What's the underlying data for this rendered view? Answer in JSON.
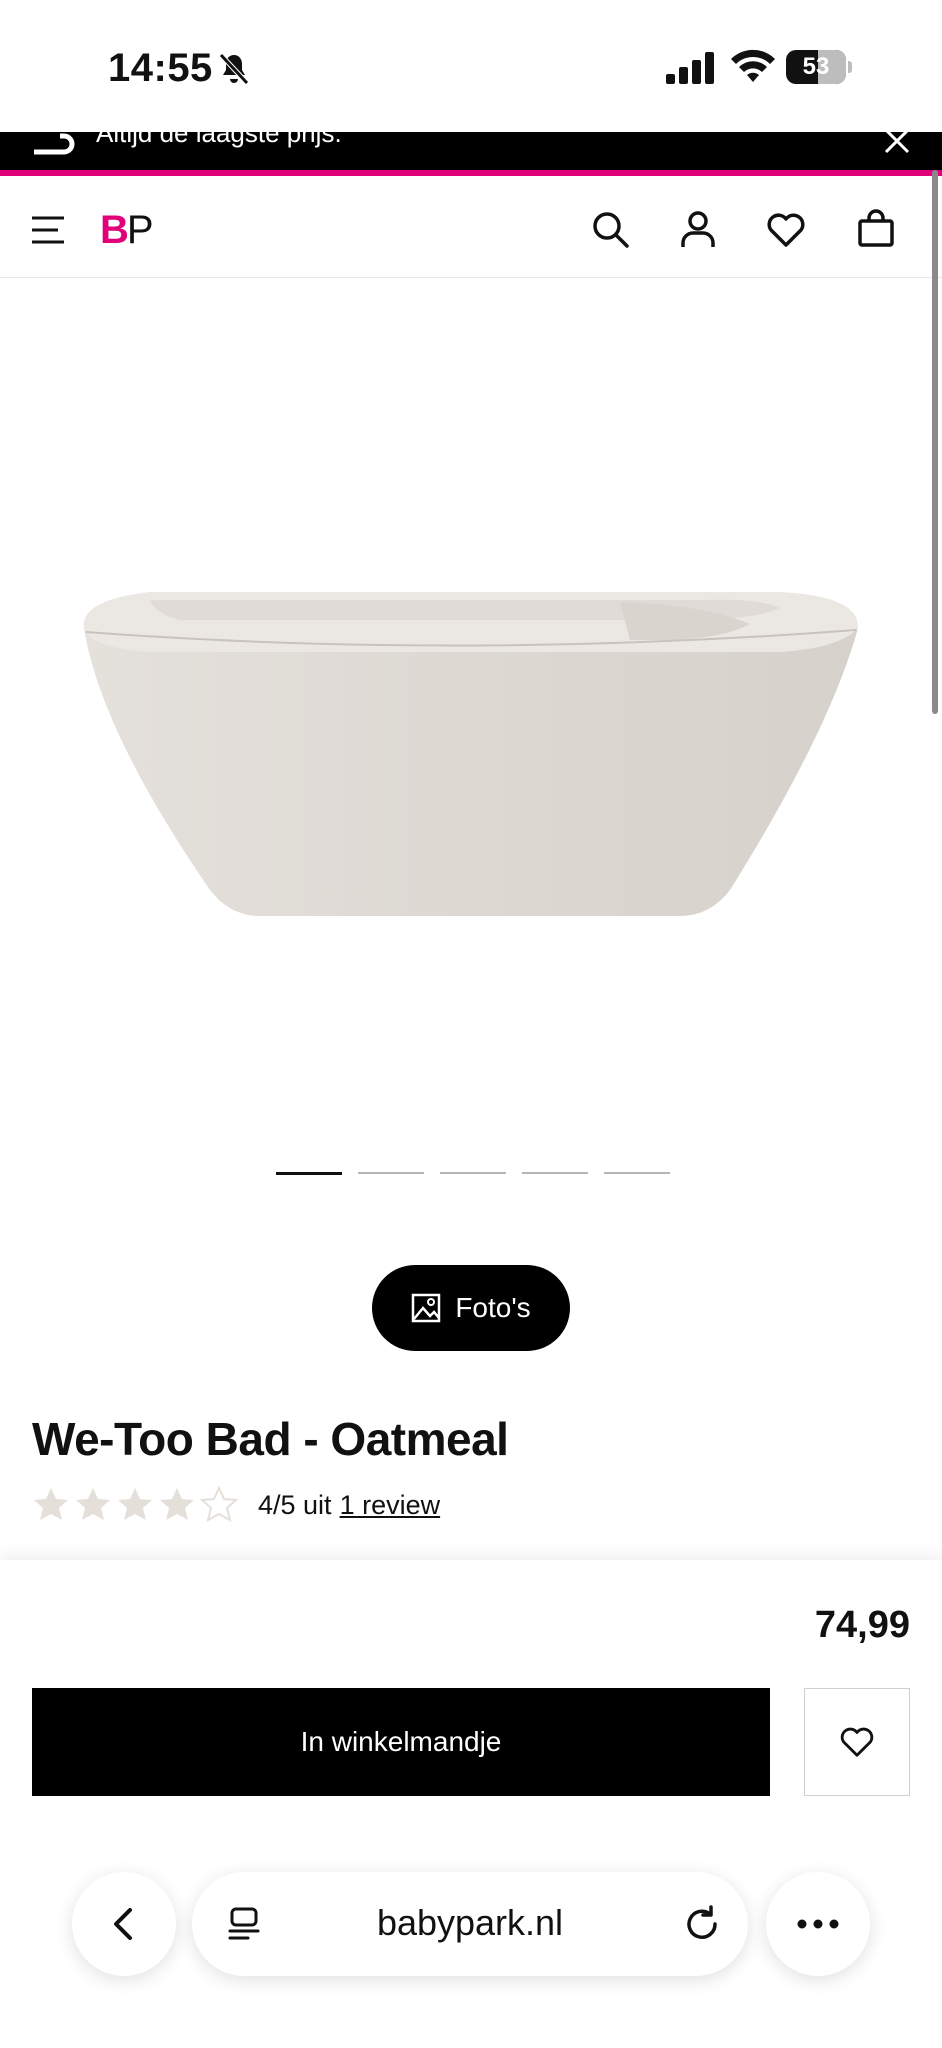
{
  "status_bar": {
    "time": "14:55",
    "battery": "53",
    "battery_level": 0.53
  },
  "promo": {
    "text": "Altijd de laagste prijs."
  },
  "header": {
    "logo_b": "B",
    "logo_p": "P"
  },
  "product": {
    "carousel_count": 5,
    "carousel_active": 1,
    "photos_label": "Foto's",
    "title": "We-Too Bad - Oatmeal",
    "rating_value": 4,
    "rating_max": 5,
    "rating_text": "4/5 uit",
    "review_link": "1  review",
    "price": "74,99",
    "add_to_cart": "In winkelmandje"
  },
  "browser": {
    "url": "babypark.nl"
  },
  "colors": {
    "brand": "#e2007a",
    "star_filled": "#e5dfda",
    "star_empty": "#e5dfda"
  }
}
